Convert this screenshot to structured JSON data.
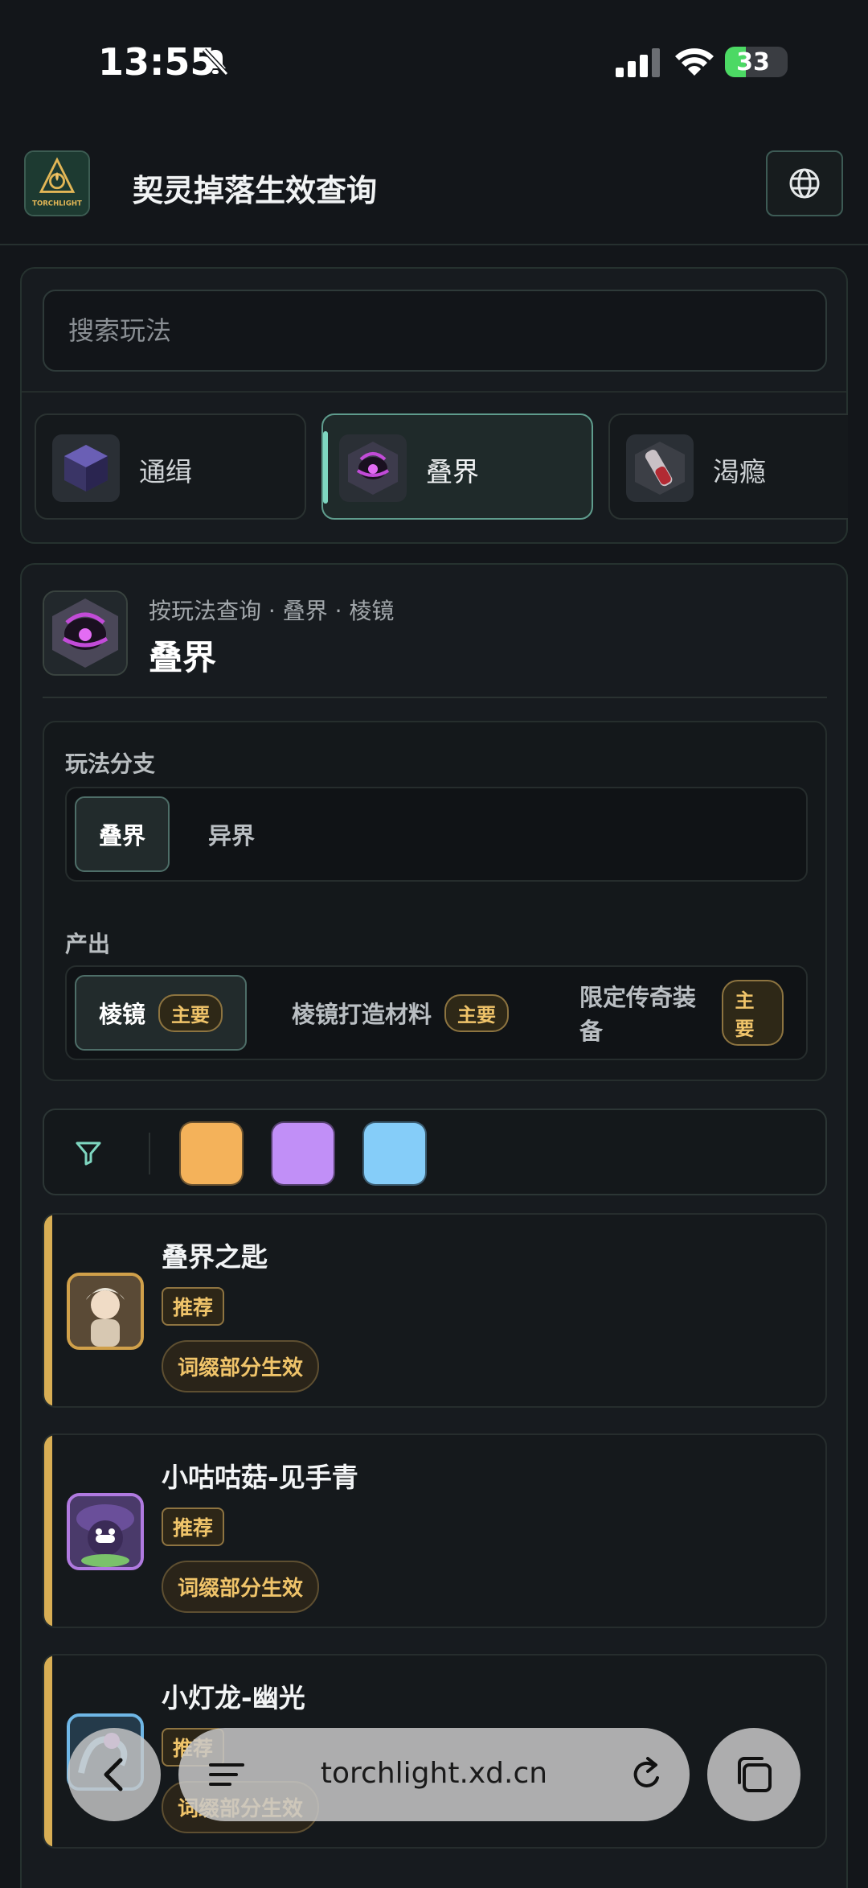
{
  "status_bar": {
    "time": "13:55",
    "battery": "33",
    "battery_level": 0.33
  },
  "header": {
    "title": "契灵掉落生效查询",
    "logo_text": "TORCHLIGHT",
    "language_icon": "globe-icon"
  },
  "search": {
    "placeholder": "搜索玩法"
  },
  "modes": [
    {
      "label": "通缉",
      "icon": "cube-icon",
      "active": false
    },
    {
      "label": "叠界",
      "icon": "rift-icon",
      "active": true
    },
    {
      "label": "渴瘾",
      "icon": "vial-icon",
      "active": false
    }
  ],
  "detail": {
    "breadcrumb": "按玩法查询 · 叠界 · 棱镜",
    "title": "叠界",
    "branch_label": "玩法分支",
    "branches": [
      {
        "label": "叠界",
        "active": true
      },
      {
        "label": "异界",
        "active": false
      }
    ],
    "output_label": "产出",
    "outputs": [
      {
        "label": "棱镜",
        "badge": "主要",
        "active": true
      },
      {
        "label": "棱镜打造材料",
        "badge": "主要",
        "active": false
      },
      {
        "label": "限定传奇装备",
        "badge": "主要",
        "active": false
      }
    ]
  },
  "color_filter": {
    "icon": "filter-icon",
    "swatches": [
      "#f4b25a",
      "#c18ff7",
      "#85cdf9"
    ]
  },
  "items": [
    {
      "name": "叠界之匙",
      "tag": "推荐",
      "effect": "词缀部分生效"
    },
    {
      "name": "小咕咕菇-见手青",
      "tag": "推荐",
      "effect": "词缀部分生效"
    },
    {
      "name": "小灯龙-幽光",
      "tag": "推荐",
      "effect": "词缀部分生效"
    }
  ],
  "browser": {
    "url": "torchlight.xd.cn"
  }
}
